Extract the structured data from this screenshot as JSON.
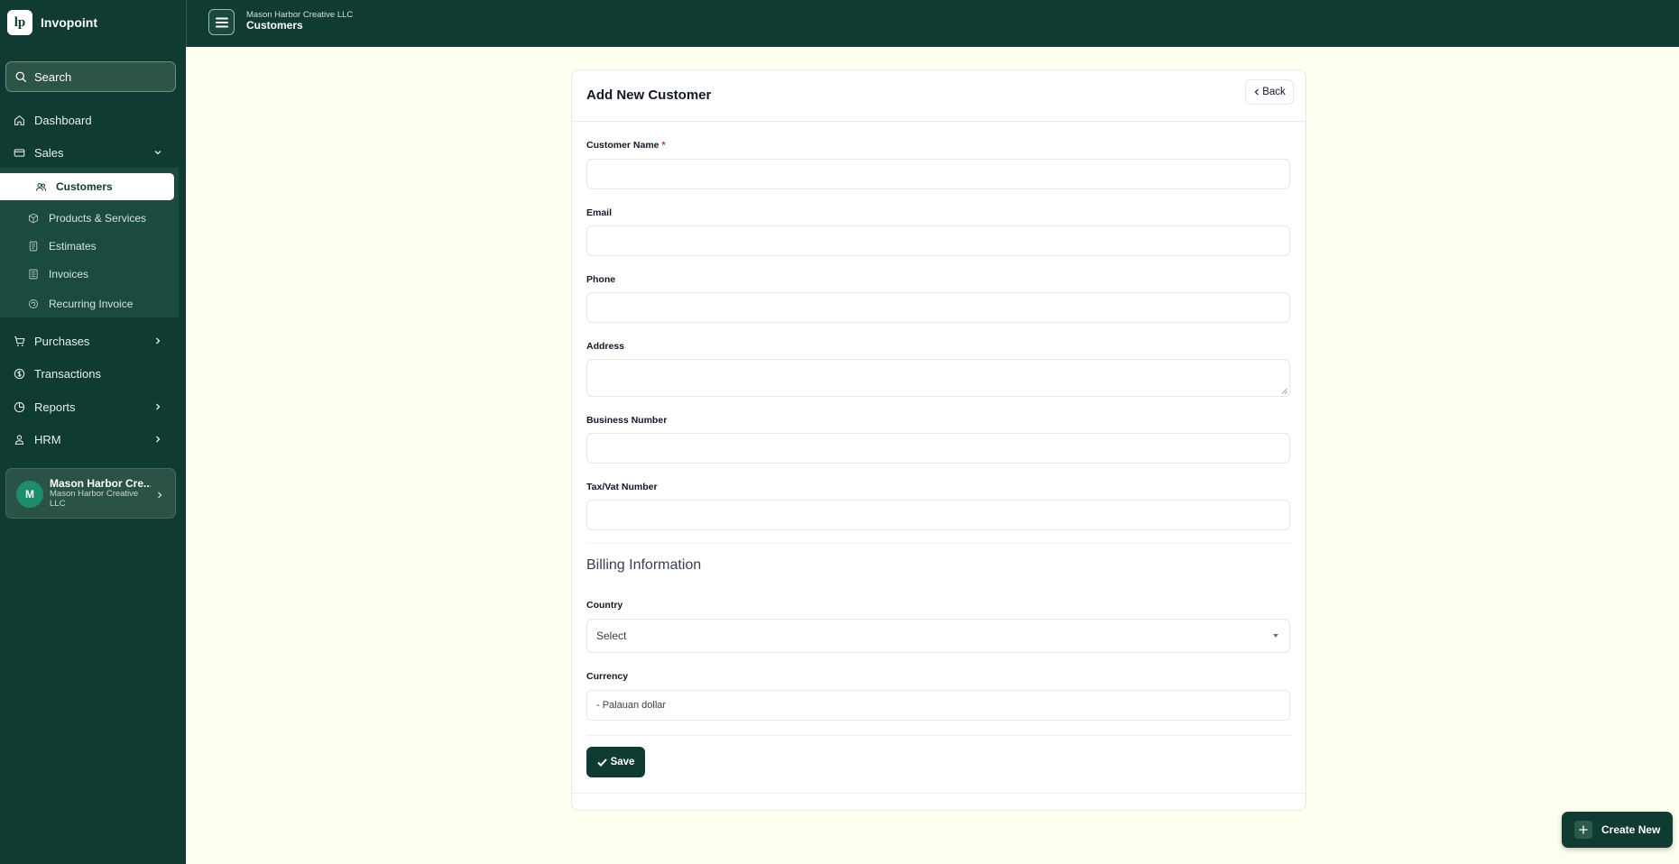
{
  "app": {
    "logo_text": "lp",
    "name": "Invopoint"
  },
  "sidebar": {
    "search_label": "Search",
    "items": {
      "dashboard": "Dashboard",
      "sales": "Sales",
      "purchases": "Purchases",
      "transactions": "Transactions",
      "reports": "Reports",
      "hrm": "HRM"
    },
    "sales_sub": {
      "customers": "Customers",
      "products": "Products & Services",
      "estimates": "Estimates",
      "invoices": "Invoices",
      "recurring": "Recurring Invoice"
    },
    "org": {
      "initial": "M",
      "name": "Mason Harbor Cre...",
      "subtitle": "Mason Harbor Creative LLC"
    }
  },
  "topbar": {
    "org": "Mason Harbor Creative LLC",
    "page": "Customers"
  },
  "form": {
    "title": "Add New Customer",
    "back_label": "Back",
    "labels": {
      "customer_name": "Customer Name",
      "required_mark": "*",
      "email": "Email",
      "phone": "Phone",
      "address": "Address",
      "business_number": "Business Number",
      "tax_number": "Tax/Vat Number",
      "country": "Country",
      "currency": "Currency"
    },
    "values": {
      "customer_name": "",
      "email": "",
      "phone": "",
      "address": "",
      "business_number": "",
      "tax_number": ""
    },
    "billing_title": "Billing Information",
    "country_selected": "Select",
    "currency_value": "- Palauan dollar",
    "save_label": "Save"
  },
  "fab": {
    "label": "Create New"
  },
  "colors": {
    "primary": "#0f3b32",
    "page_bg": "#fefff0",
    "required": "#dc2626"
  }
}
